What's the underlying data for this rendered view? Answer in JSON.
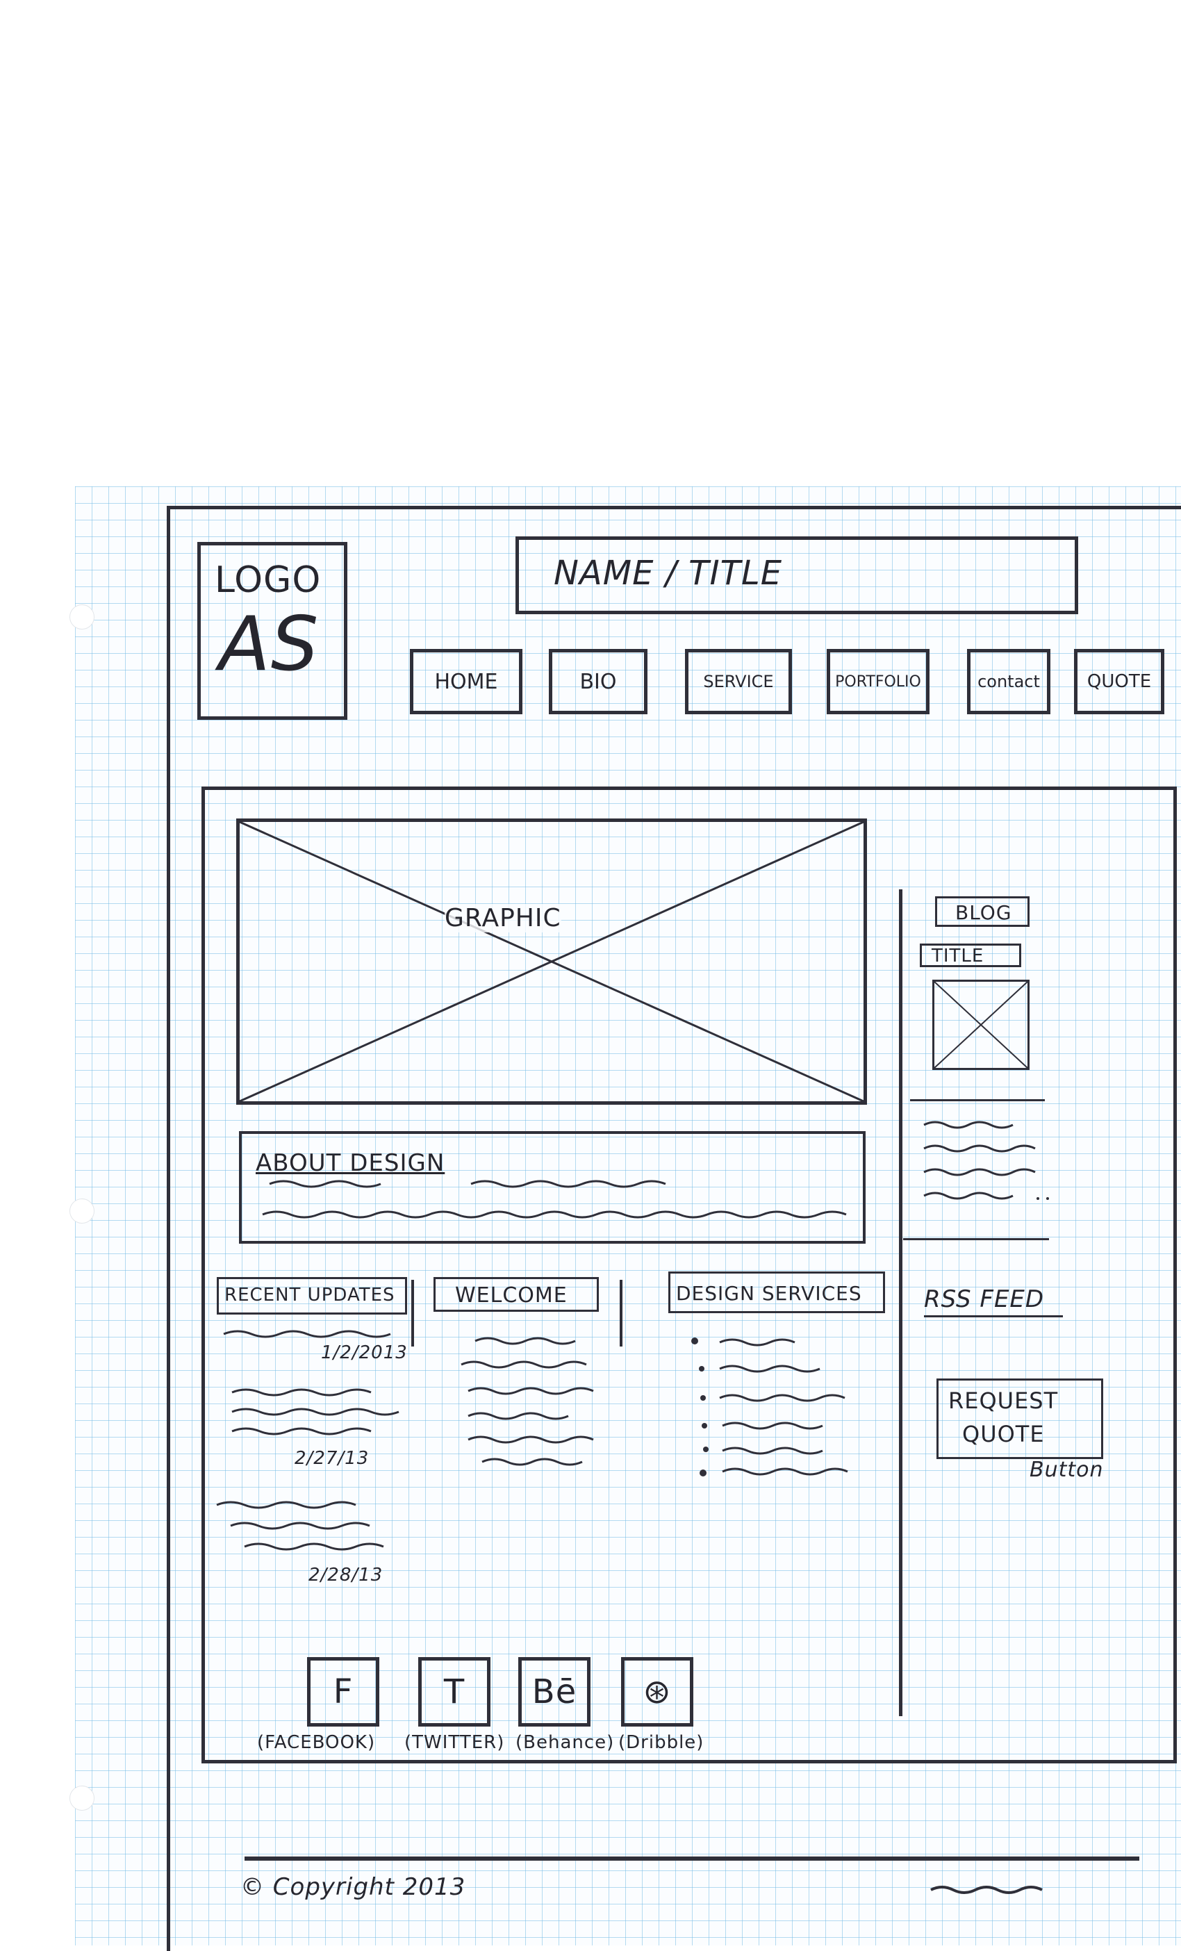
{
  "header": {
    "logo_text": "LOGO",
    "logo_initials": "AS",
    "name_title": "NAME / TITLE"
  },
  "nav": {
    "items": [
      {
        "label": "HOME"
      },
      {
        "label": "BIO"
      },
      {
        "label": "SERVICE"
      },
      {
        "label": "PORTFOLIO"
      },
      {
        "label": "contact"
      },
      {
        "label": "QUOTE"
      }
    ]
  },
  "hero": {
    "graphic_label": "GRAPHIC"
  },
  "about": {
    "title": "ABOUT DESIGN"
  },
  "sidebar": {
    "blog_label": "BLOG",
    "blog_title": "TITLE",
    "rss_label": "RSS FEED",
    "quote_button_line1": "REQUEST",
    "quote_button_line2": "QUOTE",
    "quote_button_note": "Button"
  },
  "recent_updates": {
    "title": "RECENT UPDATES",
    "dates": [
      "1/2/2013",
      "2/27/13",
      "2/28/13"
    ]
  },
  "welcome": {
    "title": "WELCOME"
  },
  "design_services": {
    "title": "DESIGN SERVICES"
  },
  "social": {
    "items": [
      {
        "glyph": "F",
        "caption": "(FACEBOOK)"
      },
      {
        "glyph": "T",
        "caption": "(TWITTER)"
      },
      {
        "glyph": "Bē",
        "caption": "(Behance)"
      },
      {
        "glyph": "⊛",
        "caption": "(Dribble)"
      }
    ]
  },
  "footer": {
    "copyright": "© Copyright 2013"
  },
  "colors": {
    "ink": "#2f2f39",
    "grid": "#78bee6",
    "paper": "#fbfdff"
  }
}
